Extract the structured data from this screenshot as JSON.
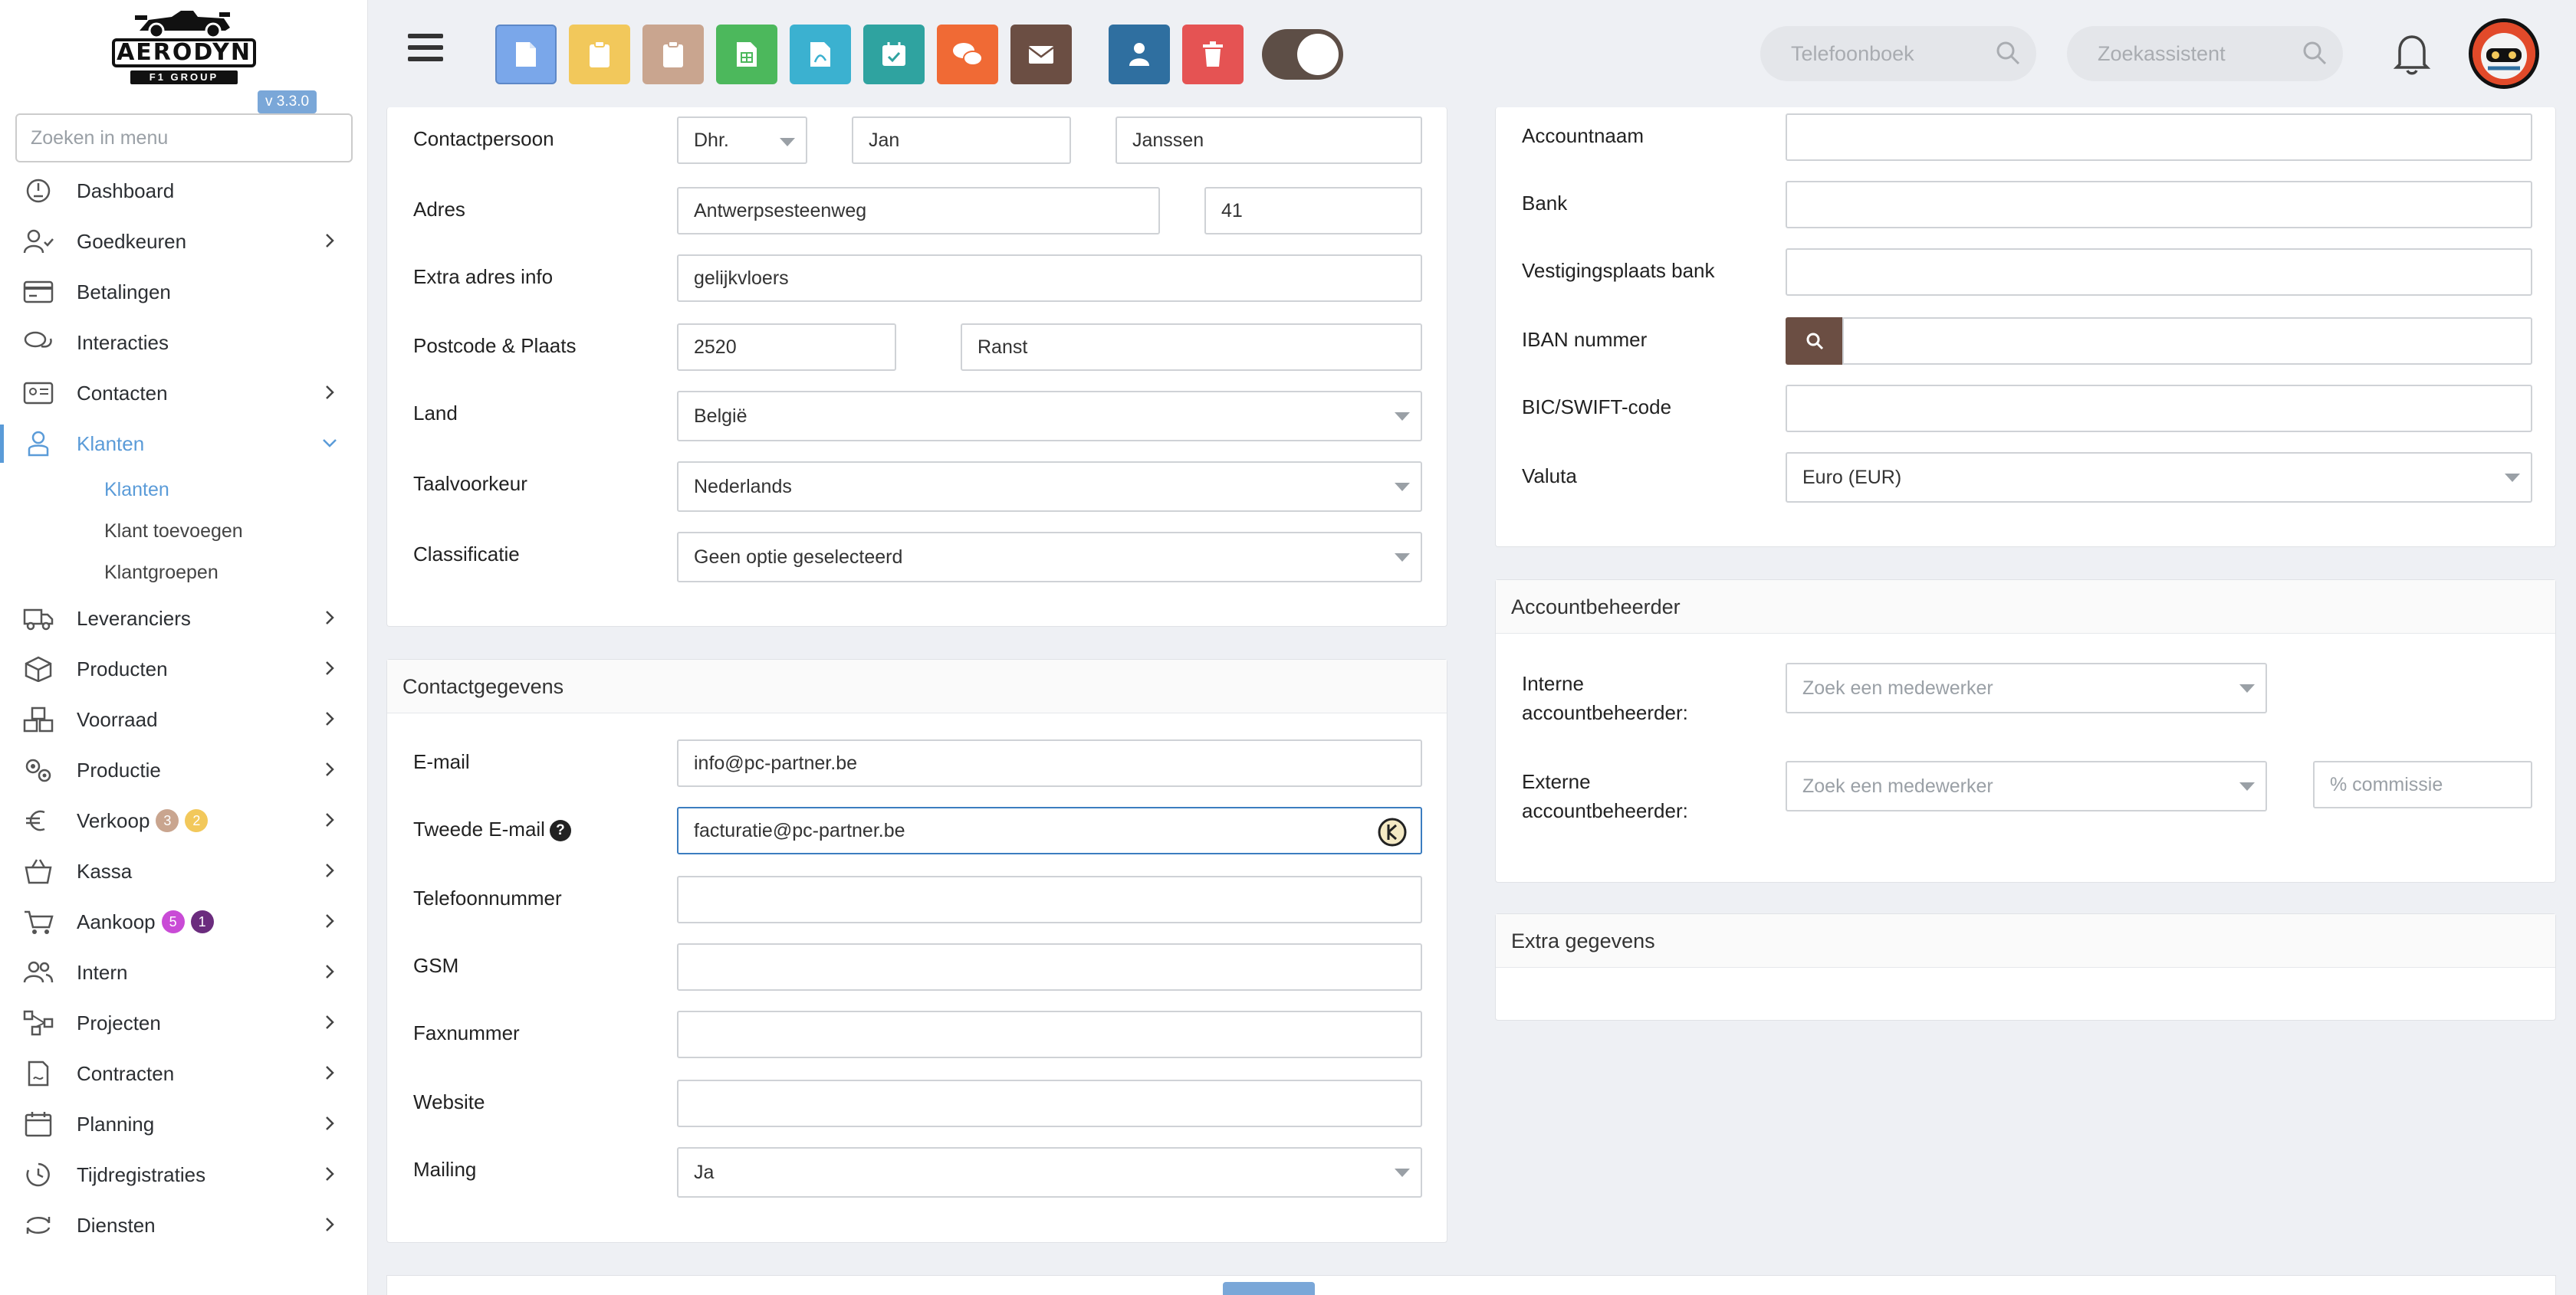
{
  "sidebar": {
    "logo_text": "AERODYN",
    "logo_sub": "F1 GROUP",
    "version": "v 3.3.0",
    "search_placeholder": "Zoeken in menu",
    "items": [
      {
        "label": "Dashboard",
        "icon": "dashboard-icon"
      },
      {
        "label": "Goedkeuren",
        "icon": "user-check-icon"
      },
      {
        "label": "Betalingen",
        "icon": "credit-card-icon"
      },
      {
        "label": "Interacties",
        "icon": "chat-icon"
      },
      {
        "label": "Contacten",
        "icon": "contact-card-icon"
      },
      {
        "label": "Klanten",
        "icon": "client-icon"
      },
      {
        "label": "Leveranciers",
        "icon": "truck-icon"
      },
      {
        "label": "Producten",
        "icon": "box-icon"
      },
      {
        "label": "Voorraad",
        "icon": "stock-icon"
      },
      {
        "label": "Productie",
        "icon": "gears-icon"
      },
      {
        "label": "Verkoop",
        "icon": "euro-icon"
      },
      {
        "label": "Kassa",
        "icon": "basket-icon"
      },
      {
        "label": "Aankoop",
        "icon": "cart-icon"
      },
      {
        "label": "Intern",
        "icon": "users-icon"
      },
      {
        "label": "Projecten",
        "icon": "projects-icon"
      },
      {
        "label": "Contracten",
        "icon": "contract-icon"
      },
      {
        "label": "Planning",
        "icon": "calendar-icon"
      },
      {
        "label": "Tijdregistraties",
        "icon": "clock-icon"
      },
      {
        "label": "Diensten",
        "icon": "refresh-icon"
      }
    ],
    "sub_items": [
      "Klanten",
      "Klant toevoegen",
      "Klantgroepen"
    ],
    "badges": {
      "verkoop_1": "3",
      "verkoop_2": "2",
      "aankoop_1": "5",
      "aankoop_2": "1"
    }
  },
  "topbar": {
    "buttons": [
      {
        "name": "document",
        "color": "#7aa7ea"
      },
      {
        "name": "clipboard-yellow",
        "color": "#f2c85b"
      },
      {
        "name": "clipboard-tan",
        "color": "#c9a58f"
      },
      {
        "name": "spreadsheet",
        "color": "#4cb85c"
      },
      {
        "name": "pdf",
        "color": "#3bb1d0"
      },
      {
        "name": "calendar-check",
        "color": "#2fa3a0"
      },
      {
        "name": "chat",
        "color": "#f06a35"
      },
      {
        "name": "mail",
        "color": "#6b4e43"
      },
      {
        "name": "user",
        "color": "#2f6fa0"
      },
      {
        "name": "trash",
        "color": "#e55353"
      }
    ],
    "search1_placeholder": "Telefoonboek",
    "search2_placeholder": "Zoekassistent"
  },
  "left_panel": {
    "rows": {
      "contactpersoon": {
        "label": "Contactpersoon",
        "salutation": "Dhr.",
        "first": "Jan",
        "last": "Janssen"
      },
      "adres": {
        "label": "Adres",
        "street": "Antwerpsesteenweg",
        "number": "41"
      },
      "extra": {
        "label": "Extra adres info",
        "value": "gelijkvloers"
      },
      "postcode": {
        "label": "Postcode & Plaats",
        "zip": "2520",
        "city": "Ranst"
      },
      "land": {
        "label": "Land",
        "value": "België"
      },
      "taal": {
        "label": "Taalvoorkeur",
        "value": "Nederlands"
      },
      "classificatie": {
        "label": "Classificatie",
        "value": "Geen optie geselecteerd"
      }
    }
  },
  "contact_panel": {
    "title": "Contactgegevens",
    "email": {
      "label": "E-mail",
      "value": "info@pc-partner.be"
    },
    "email2": {
      "label": "Tweede E-mail",
      "value": "facturatie@pc-partner.be"
    },
    "phone": {
      "label": "Telefoonnummer",
      "value": ""
    },
    "gsm": {
      "label": "GSM",
      "value": ""
    },
    "fax": {
      "label": "Faxnummer",
      "value": ""
    },
    "website": {
      "label": "Website",
      "value": ""
    },
    "mailing": {
      "label": "Mailing",
      "value": "Ja"
    }
  },
  "bank_panel": {
    "account": {
      "label": "Accountnaam",
      "value": ""
    },
    "bank": {
      "label": "Bank",
      "value": ""
    },
    "branch": {
      "label": "Vestigingsplaats bank",
      "value": ""
    },
    "iban": {
      "label": "IBAN nummer",
      "value": ""
    },
    "bic": {
      "label": "BIC/SWIFT-code",
      "value": ""
    },
    "valuta": {
      "label": "Valuta",
      "value": "Euro (EUR)"
    }
  },
  "manager_panel": {
    "title": "Accountbeheerder",
    "intern_label_1": "Interne",
    "intern_label_2": "accountbeheerder:",
    "extern_label_1": "Externe",
    "extern_label_2": "accountbeheerder:",
    "employee_placeholder": "Zoek een medewerker",
    "commission_placeholder": "% commissie"
  },
  "extra_panel": {
    "title": "Extra gegevens"
  }
}
